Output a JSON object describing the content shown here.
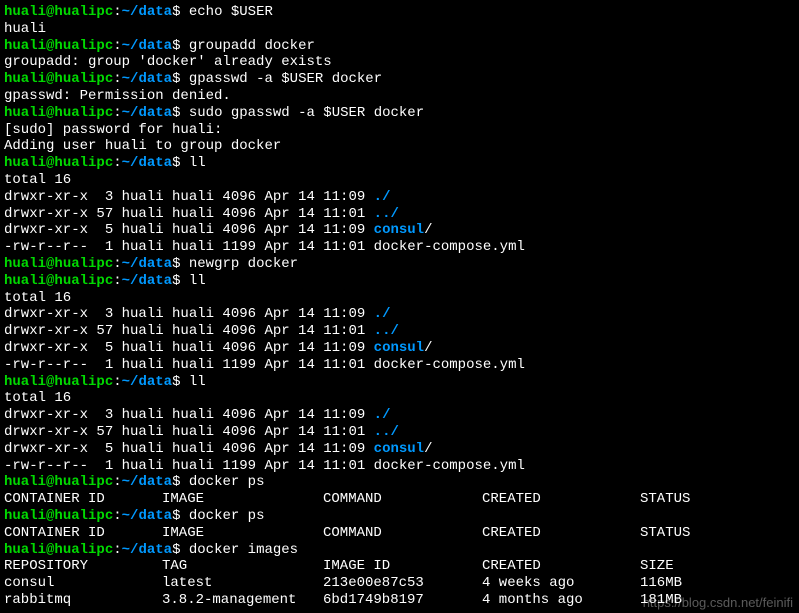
{
  "prompt": {
    "user": "huali",
    "at": "@",
    "host": "hualipc",
    "colon": ":",
    "path": "~/data",
    "dollar": "$"
  },
  "lines": {
    "cmd1": " echo $USER",
    "out1": "huali",
    "cmd2": " groupadd docker",
    "out2": "groupadd: group 'docker' already exists",
    "cmd3": " gpasswd -a $USER docker",
    "out3": "gpasswd: Permission denied.",
    "cmd4": " sudo gpasswd -a $USER docker",
    "out4a": "[sudo] password for huali:",
    "out4b": "Adding user huali to group docker",
    "cmd5": " ll",
    "total": "total 16",
    "ls1a": "drwxr-xr-x  3 huali huali 4096 Apr 14 11:09 ",
    "ls1b": "./",
    "ls2a": "drwxr-xr-x 57 huali huali 4096 Apr 14 11:01 ",
    "ls2b": "../",
    "ls3a": "drwxr-xr-x  5 huali huali 4096 Apr 14 11:09 ",
    "ls3b": "consul",
    "ls3c": "/",
    "ls4": "-rw-r--r--  1 huali huali 1199 Apr 14 11:01 docker-compose.yml",
    "cmd6": " newgrp docker",
    "cmd7": " ll",
    "cmd8": " ll",
    "cmd9": " docker ps",
    "cmd10": " docker ps",
    "cmd11": " docker images",
    "ps_h1": "CONTAINER ID",
    "ps_h2": "IMAGE",
    "ps_h3": "COMMAND",
    "ps_h4": "CREATED",
    "ps_h5": "STATUS",
    "img_h1": "REPOSITORY",
    "img_h2": "TAG",
    "img_h3": "IMAGE ID",
    "img_h4": "CREATED",
    "img_h5": "SIZE",
    "img_r1c1": "consul",
    "img_r1c2": "latest",
    "img_r1c3": "213e00e87c53",
    "img_r1c4": "4 weeks ago",
    "img_r1c5": "116MB",
    "img_r2c1": "rabbitmq",
    "img_r2c2": "3.8.2-management",
    "img_r2c3": "6bd1749b8197",
    "img_r2c4": "4 months ago",
    "img_r2c5": "181MB"
  },
  "watermark": "https://blog.csdn.net/feinifi"
}
